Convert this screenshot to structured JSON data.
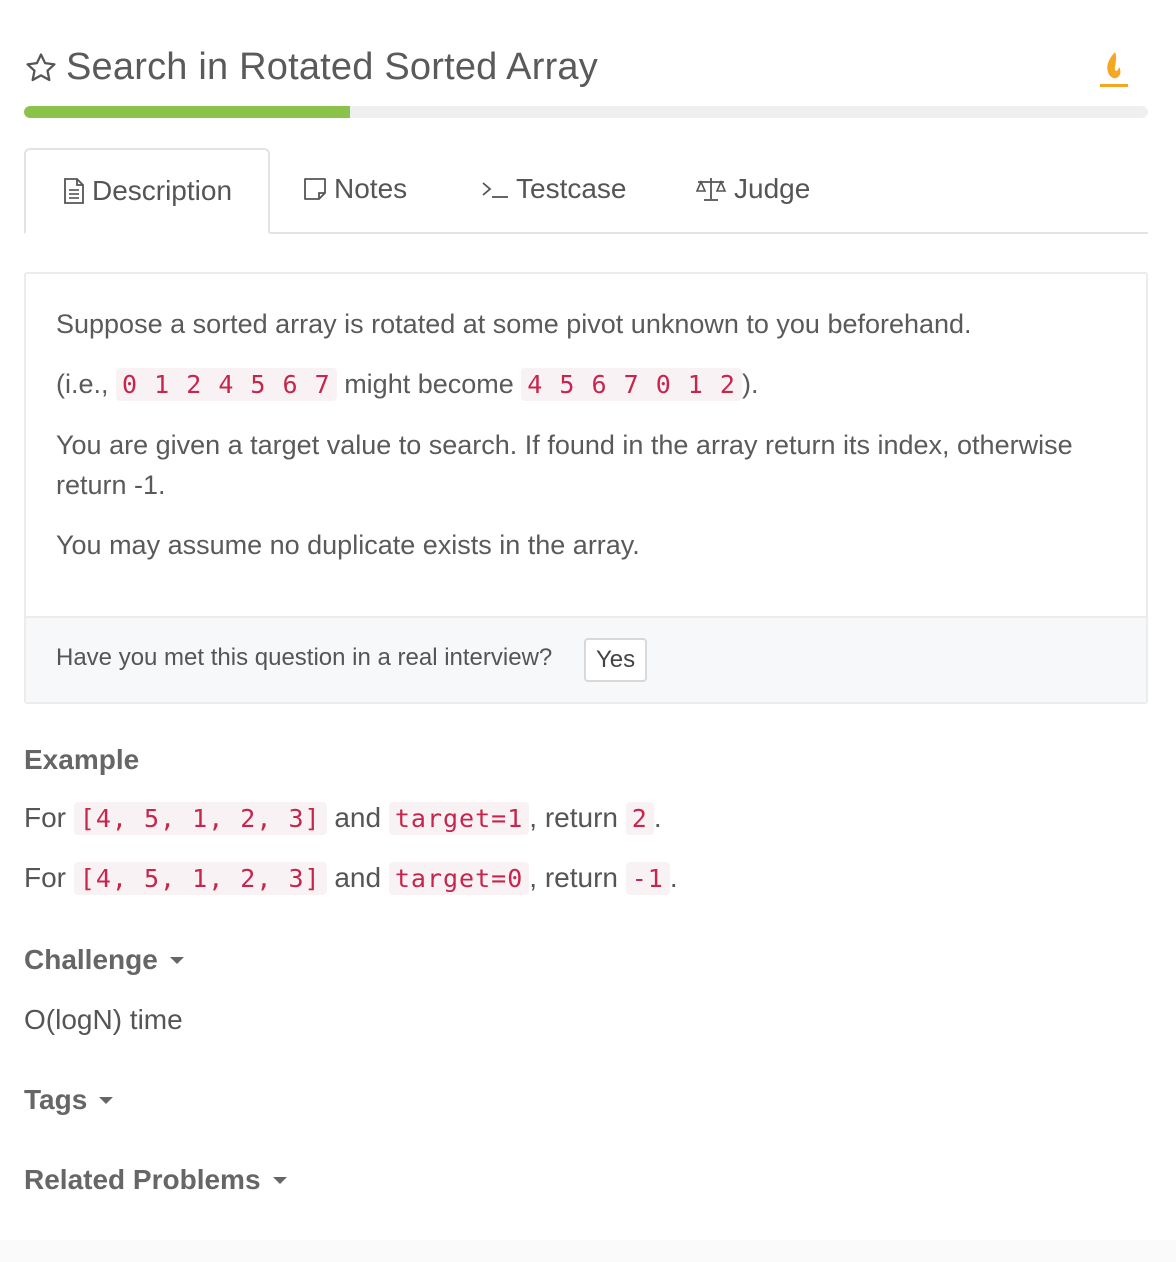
{
  "header": {
    "title": "Search in Rotated Sorted Array",
    "progress_fraction": 0.29
  },
  "tabs": [
    {
      "label": "Description",
      "active": true
    },
    {
      "label": "Notes"
    },
    {
      "label": "Testcase"
    },
    {
      "label": "Judge"
    }
  ],
  "description": {
    "p1": "Suppose a sorted array is rotated at some pivot unknown to you beforehand.",
    "p2_pre": "(i.e., ",
    "p2_code1": "0 1 2 4 5 6 7",
    "p2_mid": " might become ",
    "p2_code2": "4 5 6 7 0 1 2",
    "p2_post": ").",
    "p3": "You are given a target value to search. If found in the array return its index, otherwise return -1.",
    "p4": "You may assume no duplicate exists in the array.",
    "footer_question": "Have you met this question in a real interview?",
    "yes_label": "Yes"
  },
  "example": {
    "heading": "Example",
    "lines": [
      {
        "for": "For ",
        "arr": "[4, 5, 1, 2, 3]",
        "and": " and ",
        "target": "target=1",
        "ret": ", return ",
        "result": "2",
        "end": "."
      },
      {
        "for": "For ",
        "arr": "[4, 5, 1, 2, 3]",
        "and": " and ",
        "target": "target=0",
        "ret": ", return ",
        "result": "-1",
        "end": "."
      }
    ]
  },
  "challenge": {
    "heading": "Challenge",
    "text": "O(logN) time"
  },
  "tags": {
    "heading": "Tags"
  },
  "related": {
    "heading": "Related Problems"
  }
}
